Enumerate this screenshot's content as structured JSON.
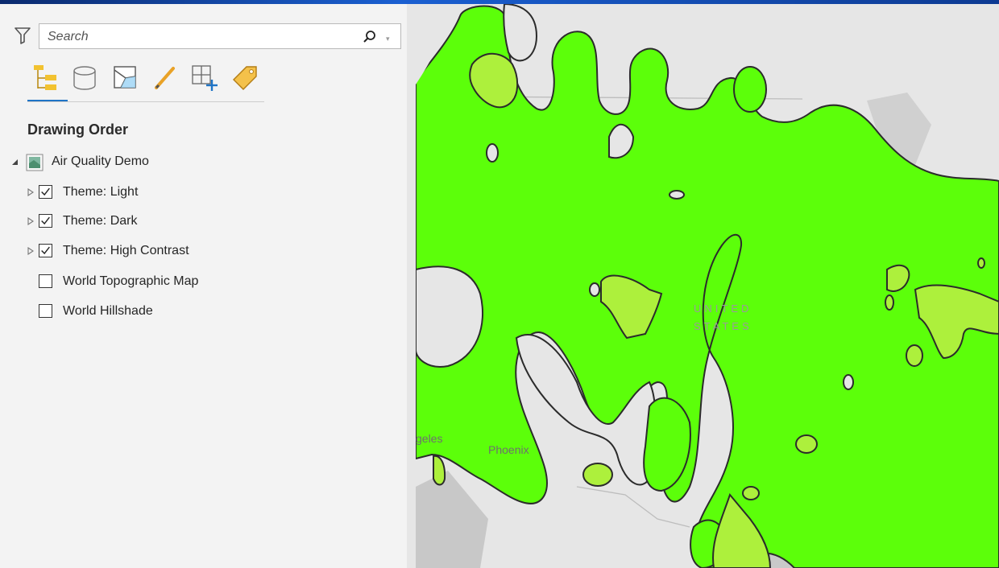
{
  "search": {
    "placeholder": "Search"
  },
  "toolbar": {
    "buttons": [
      {
        "name": "drawing-order-icon",
        "active": true
      },
      {
        "name": "data-source-icon"
      },
      {
        "name": "selection-icon"
      },
      {
        "name": "editing-icon"
      },
      {
        "name": "snapping-icon"
      },
      {
        "name": "labeling-icon"
      }
    ]
  },
  "section": {
    "title": "Drawing Order"
  },
  "tree": {
    "map_name": "Air Quality Demo",
    "layers": [
      {
        "label": "Theme: Light",
        "checked": true,
        "expandable": true
      },
      {
        "label": "Theme: Dark",
        "checked": true,
        "expandable": true
      },
      {
        "label": "Theme: High Contrast",
        "checked": true,
        "expandable": true
      },
      {
        "label": "World Topographic Map",
        "checked": false,
        "expandable": false
      },
      {
        "label": "World Hillshade",
        "checked": false,
        "expandable": false
      }
    ]
  },
  "map": {
    "labels": {
      "angeles": "geles",
      "phoenix": "Phoenix",
      "country": "UNITED STATES"
    },
    "colors": {
      "good": "#5cff0a",
      "moderate": "#adf03c",
      "base": "#e8e8e8",
      "outline": "#2b2b2b",
      "accent": "#1f74c6"
    }
  }
}
